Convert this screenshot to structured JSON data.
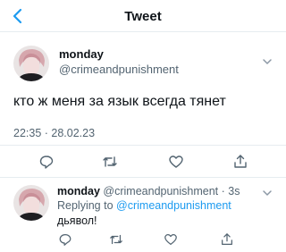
{
  "header": {
    "title": "Tweet"
  },
  "tweet": {
    "display_name": "monday",
    "handle": "@crimeandpunishment",
    "text": "кто ж меня за язык всегда тянет",
    "timestamp": "22:35 · 28.02.23"
  },
  "reply": {
    "display_name": "monday",
    "handle_time": "@crimeandpunishment · 3s",
    "replying_prefix": "Replying to",
    "replying_to": "@crimeandpunishment",
    "text": "дьявол!"
  },
  "colors": {
    "accent": "#1d9bf0",
    "muted": "#536471",
    "divider": "#e6ecf0"
  },
  "icons": [
    "back-arrow-icon",
    "chevron-down-icon",
    "reply-icon",
    "retweet-icon",
    "like-icon",
    "share-icon"
  ]
}
